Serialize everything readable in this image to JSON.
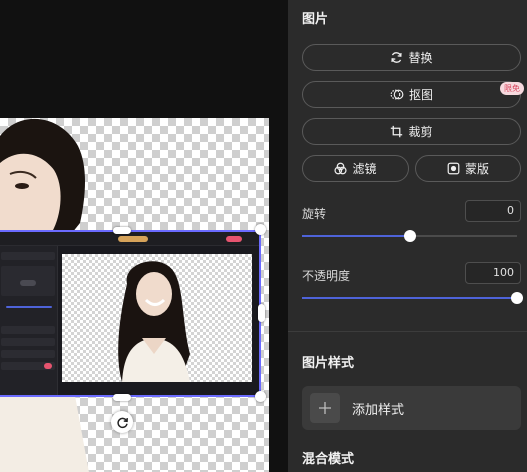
{
  "panel": {
    "image_section_title": "图片",
    "replace_label": "替换",
    "cutout_label": "抠图",
    "cutout_badge": "限免",
    "crop_label": "裁剪",
    "filter_label": "滤镜",
    "mask_label": "蒙版",
    "rotation_label": "旋转",
    "rotation_value": "0",
    "rotation_fraction": 0.5,
    "opacity_label": "不透明度",
    "opacity_value": "100",
    "opacity_fraction": 1.0,
    "style_section_title": "图片样式",
    "add_style_label": "添加样式",
    "blend_section_title": "混合模式"
  },
  "colors": {
    "panel_bg": "#2b2b2b",
    "accent_slider": "#4e63d9",
    "selection_border": "#6b6bff",
    "badge_bg": "#f7d9de",
    "badge_text": "#d9465f"
  },
  "icons": {
    "replace": "refresh-icon",
    "cutout": "cutout-icon",
    "crop": "crop-icon",
    "filter": "filter-icon",
    "mask": "mask-icon",
    "add": "plus-icon",
    "rotate": "rotate-icon"
  }
}
